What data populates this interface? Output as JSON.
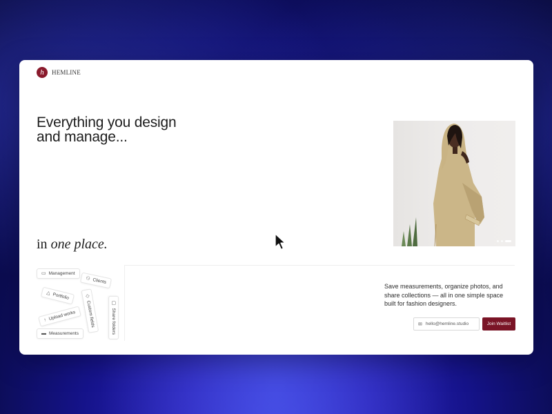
{
  "brand": {
    "name": "HEMLINE",
    "mark": "h",
    "color": "#7a1426"
  },
  "hero": {
    "headline_line1": "Everything you design",
    "headline_line2": "and manage...",
    "tagline_prefix": "in ",
    "tagline_emphasis": "one place.",
    "carousel": {
      "slides": 3,
      "active_index": 2
    }
  },
  "features": [
    {
      "label": "Management",
      "icon": "id-card-icon"
    },
    {
      "label": "Clients",
      "icon": "user-icon"
    },
    {
      "label": "Portfolio",
      "icon": "shapes-icon"
    },
    {
      "label": "Custom fields",
      "icon": "tag-icon"
    },
    {
      "label": "Share folders",
      "icon": "folder-share-icon"
    },
    {
      "label": "Upload works",
      "icon": "upload-icon"
    },
    {
      "label": "Measurements",
      "icon": "ruler-icon"
    }
  ],
  "description": "Save measurements, organize photos, and share collections — all in one simple space built for fashion designers.",
  "waitlist": {
    "email_value": "hello@hemline.studio",
    "button_label": "Join Waitlist"
  }
}
